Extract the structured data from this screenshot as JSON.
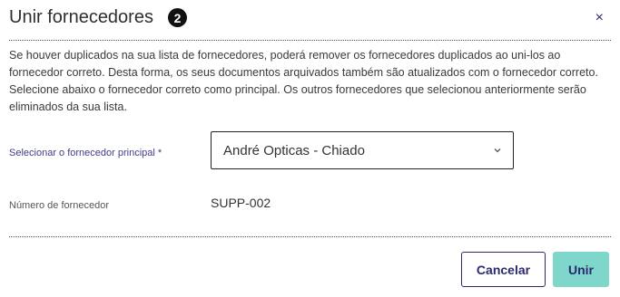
{
  "dialog": {
    "title": "Unir fornecedores",
    "step_badge": "2",
    "close_icon": "×",
    "description": "Se houver duplicados na sua lista de fornecedores, poderá remover os fornecedores duplicados ao uni-los ao fornecedor correto. Desta forma, os seus documentos arquivados também são atualizados com o fornecedor correto. Selecione abaixo o fornecedor correto como principal. Os outros fornecedores que selecionou anteriormente serão eliminados da sua lista."
  },
  "form": {
    "supplier_label": "Selecionar o fornecedor principal *",
    "supplier_selected": "André Opticas - Chiado",
    "number_label": "Número de fornecedor",
    "number_value": "SUPP-002"
  },
  "actions": {
    "cancel_label": "Cancelar",
    "confirm_label": "Unir"
  },
  "colors": {
    "primary": "#2b2a6e",
    "accent": "#7fd6cb"
  }
}
